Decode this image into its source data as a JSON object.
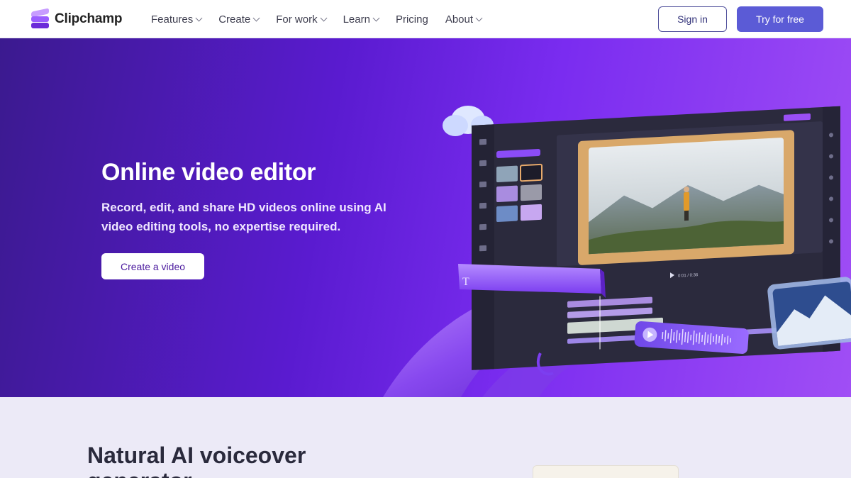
{
  "brand": {
    "name": "Clipchamp"
  },
  "nav": {
    "items": [
      {
        "label": "Features",
        "dropdown": true
      },
      {
        "label": "Create",
        "dropdown": true
      },
      {
        "label": "For work",
        "dropdown": true
      },
      {
        "label": "Learn",
        "dropdown": true
      },
      {
        "label": "Pricing",
        "dropdown": false
      },
      {
        "label": "About",
        "dropdown": true
      }
    ],
    "signin_label": "Sign in",
    "try_label": "Try for free"
  },
  "hero": {
    "title": "Online video editor",
    "subtitle": "Record, edit, and share HD videos online using AI video editing tools, no expertise required.",
    "cta_label": "Create a video",
    "editor_timecode": "0:01 / 0:36"
  },
  "section2": {
    "title": "Natural AI voiceover generator"
  },
  "colors": {
    "accent": "#5b5bd6",
    "hero_start": "#3b1a8f",
    "hero_end": "#a04ef5",
    "section_bg": "#eceaf7"
  },
  "icons": [
    "chevron-down-icon",
    "play-icon",
    "text-icon",
    "cloud-icon"
  ]
}
